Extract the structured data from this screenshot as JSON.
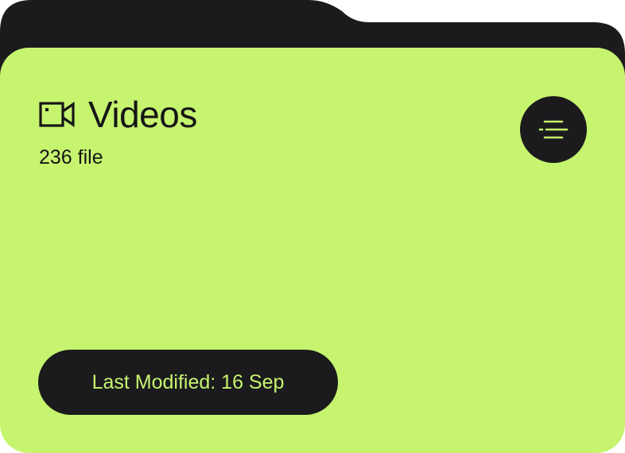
{
  "folder": {
    "icon": "video-camera-icon",
    "title": "Videos",
    "file_count": "236 file",
    "menu_icon": "list-filter-icon",
    "last_modified": "Last Modified: 16 Sep"
  },
  "colors": {
    "accent": "#c6f46f",
    "dark": "#1b1b1d",
    "text": "#161616"
  }
}
